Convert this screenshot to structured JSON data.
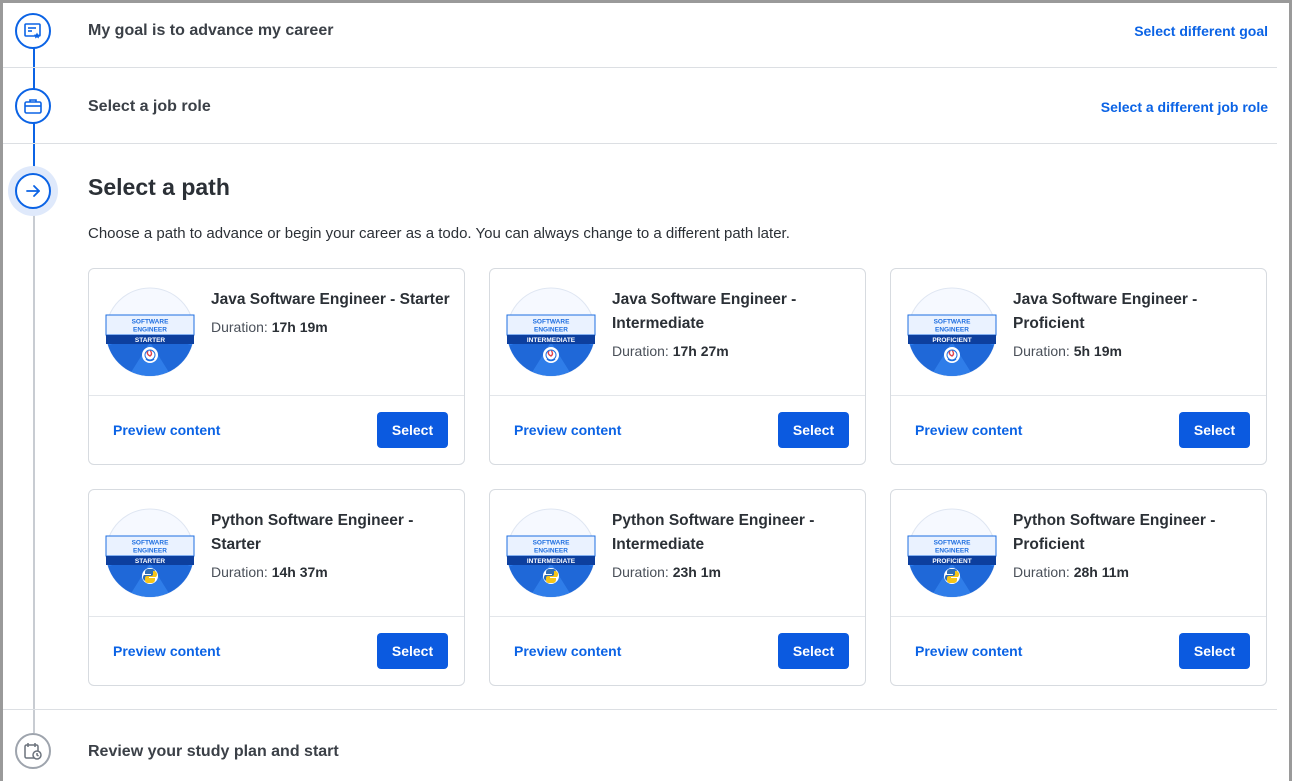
{
  "steps": {
    "goal": {
      "title": "My goal is to advance my career",
      "link": "Select different goal",
      "icon": "certificate-star-icon"
    },
    "job_role": {
      "title": "Select a job role",
      "link": "Select a different job role",
      "icon": "briefcase-icon"
    },
    "path": {
      "title": "Select a path",
      "description": "Choose a path to advance or begin your career as a todo. You can always change to a different path later.",
      "icon": "arrow-right-icon"
    },
    "review": {
      "title": "Review your study plan and start",
      "icon": "calendar-clock-icon"
    }
  },
  "duration_label": "Duration:",
  "preview_label": "Preview content",
  "select_label": "Select",
  "badge_top": [
    "SOFTWARE",
    "ENGINEER"
  ],
  "cards": [
    {
      "title": "Java Software Engineer - Starter",
      "duration": "17h 19m",
      "level": "STARTER",
      "tech": "java"
    },
    {
      "title": "Java Software Engineer - Intermediate",
      "duration": "17h 27m",
      "level": "INTERMEDIATE",
      "tech": "java"
    },
    {
      "title": "Java Software Engineer - Proficient",
      "duration": "5h 19m",
      "level": "PROFICIENT",
      "tech": "java"
    },
    {
      "title": "Python Software Engineer - Starter",
      "duration": "14h 37m",
      "level": "STARTER",
      "tech": "python"
    },
    {
      "title": "Python Software Engineer - Intermediate",
      "duration": "23h 1m",
      "level": "INTERMEDIATE",
      "tech": "python"
    },
    {
      "title": "Python Software Engineer - Proficient",
      "duration": "28h 11m",
      "level": "PROFICIENT",
      "tech": "python"
    }
  ],
  "colors": {
    "accent": "#0b63e5",
    "button": "#0b5ae0",
    "badge_blue": "#1f6fe0"
  }
}
